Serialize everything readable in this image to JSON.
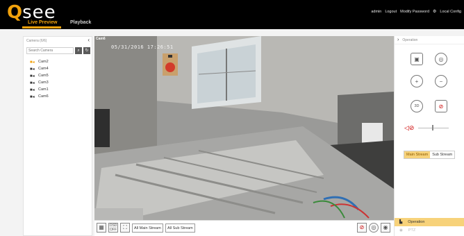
{
  "header": {
    "logo_q": "Q",
    "logo_rest": "see",
    "tabs": [
      {
        "label": "Live Preview",
        "active": true
      },
      {
        "label": "Playback",
        "active": false
      }
    ],
    "links": {
      "user": "admin",
      "logout": "Logout",
      "modify_password": "Modify Password",
      "local_config": "Local Config"
    },
    "accent": "#f2a20c"
  },
  "camera_panel": {
    "title": "Camera (6/6)",
    "search_placeholder": "Search Camera",
    "cameras": [
      {
        "label": "Cam2",
        "active": true
      },
      {
        "label": "Cam4",
        "active": false
      },
      {
        "label": "Cam5",
        "active": false
      },
      {
        "label": "Cam3",
        "active": false
      },
      {
        "label": "Cam1",
        "active": false
      },
      {
        "label": "Cam6",
        "active": false
      }
    ]
  },
  "video": {
    "channel_label": "Cam6",
    "timestamp": "05/31/2016 17:26:51"
  },
  "bottom_bar": {
    "all_main_stream": "All Main Stream",
    "all_sub_stream": "All Sub Stream"
  },
  "operation_panel": {
    "title": "Operation",
    "main_stream": "Main Stream",
    "sub_stream": "Sub Stream",
    "operation_tab": "Operation",
    "ptz_tab": "PTZ",
    "volume_level": 0.45
  }
}
